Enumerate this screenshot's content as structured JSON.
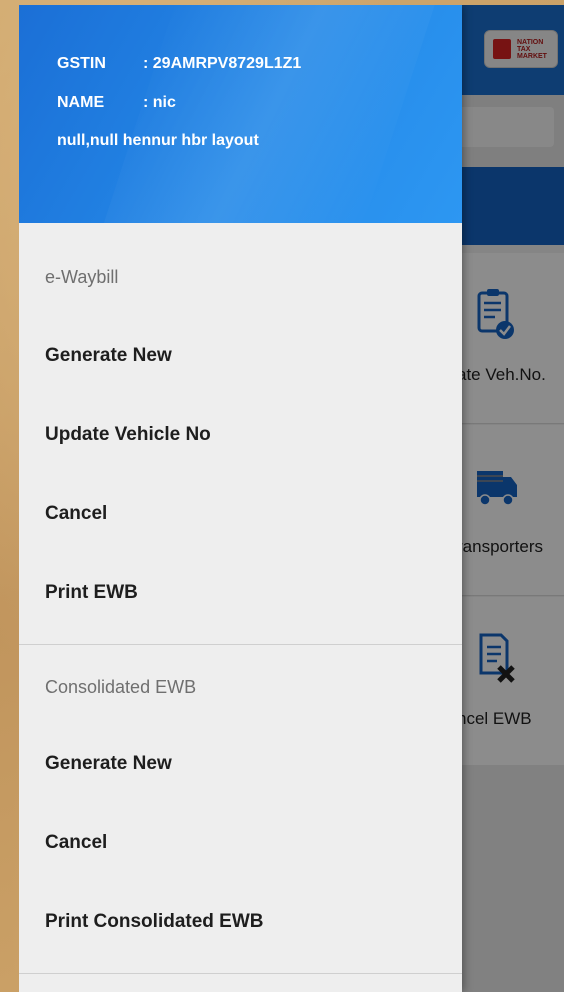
{
  "drawer": {
    "header": {
      "gstin_label": "GSTIN",
      "gstin_value": ": 29AMRPV8729L1Z1",
      "name_label": "NAME",
      "name_value": ": nic",
      "address": "null,null  hennur hbr layout"
    },
    "sections": [
      {
        "title": "e-Waybill",
        "items": [
          {
            "label": "Generate New"
          },
          {
            "label": "Update Vehicle No"
          },
          {
            "label": "Cancel"
          },
          {
            "label": "Print EWB"
          }
        ]
      },
      {
        "title": "Consolidated EWB",
        "items": [
          {
            "label": "Generate New"
          },
          {
            "label": "Cancel"
          },
          {
            "label": "Print Consolidated EWB"
          }
        ]
      }
    ]
  },
  "background_app": {
    "logo_text": "NATION TAX MARKET",
    "tiles": [
      {
        "label": "ate Veh.No.",
        "icon": "clipboard-check-icon"
      },
      {
        "label": "ransporters",
        "icon": "truck-icon"
      },
      {
        "label": "ncel EWB",
        "icon": "document-cancel-icon"
      }
    ]
  },
  "colors": {
    "header_blue": "#1b6fd6",
    "drawer_bg": "#eeeeee",
    "icon_blue": "#1463c4"
  }
}
